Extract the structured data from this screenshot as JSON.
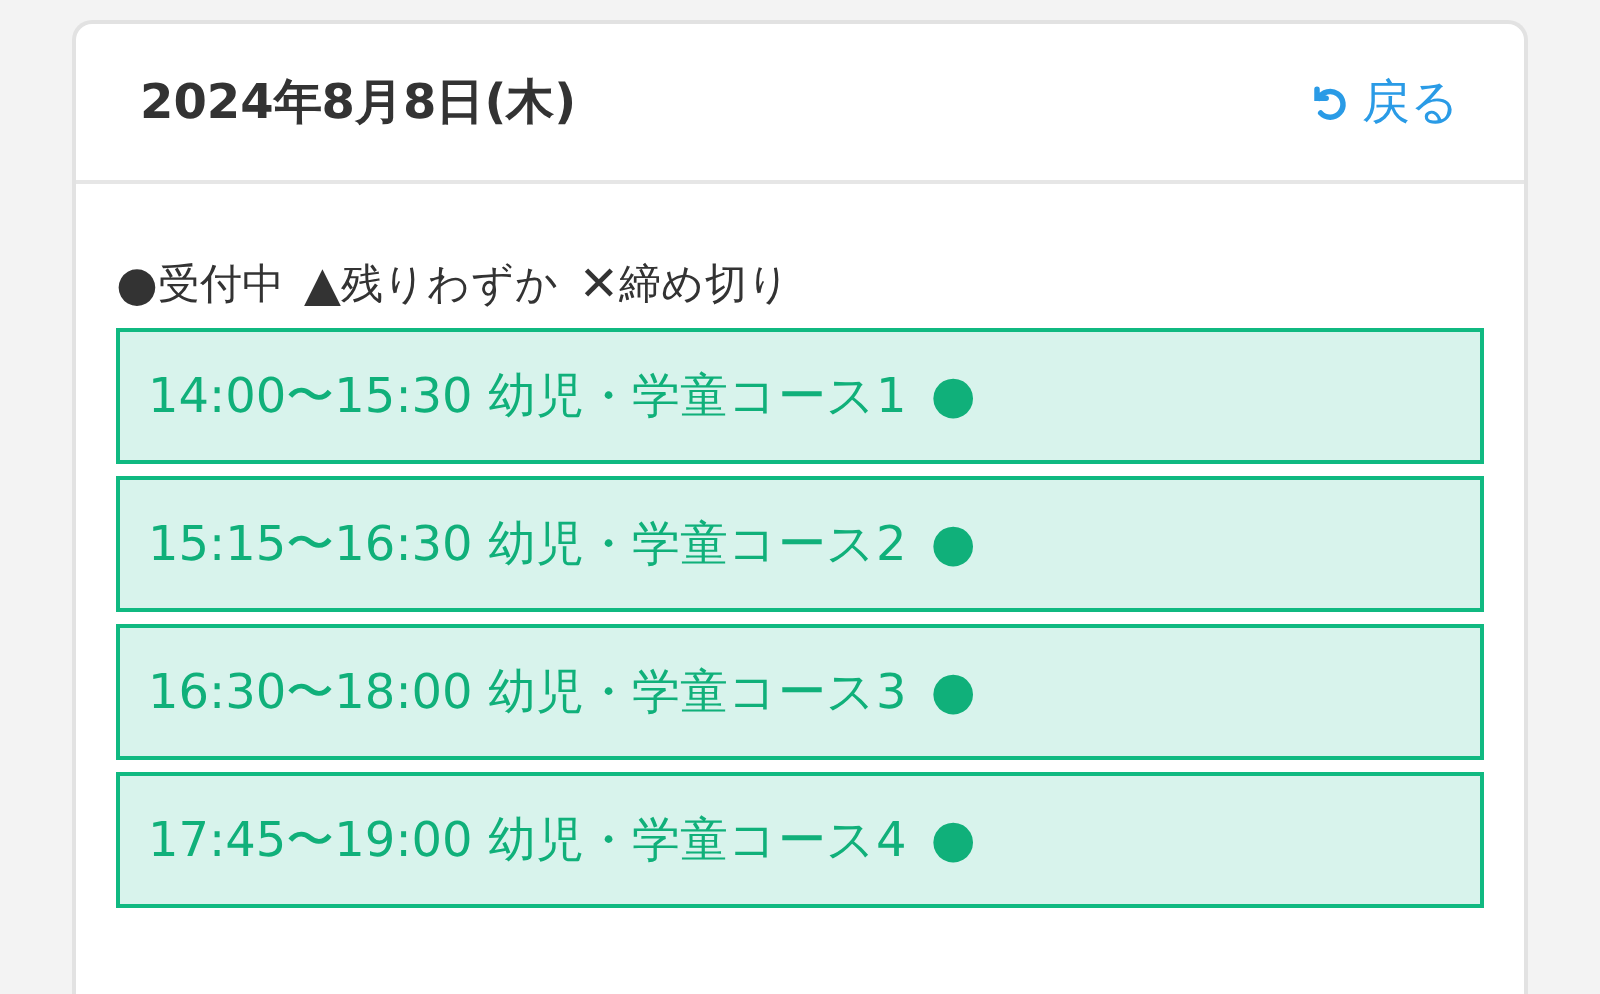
{
  "header": {
    "date": "2024年8月8日(木)",
    "back_link": "戻る"
  },
  "legend": [
    {
      "mark": "●",
      "label": "受付中"
    },
    {
      "mark": "▲",
      "label": "残りわずか"
    },
    {
      "mark": "✕",
      "label": "締め切り"
    }
  ],
  "slots": [
    {
      "label": "14:00〜15:30 幼児・学童コース1",
      "mark": "●"
    },
    {
      "label": "15:15〜16:30 幼児・学童コース2",
      "mark": "●"
    },
    {
      "label": "16:30〜18:00 幼児・学童コース3",
      "mark": "●"
    },
    {
      "label": "17:45〜19:00 幼児・学童コース4",
      "mark": "●"
    }
  ]
}
